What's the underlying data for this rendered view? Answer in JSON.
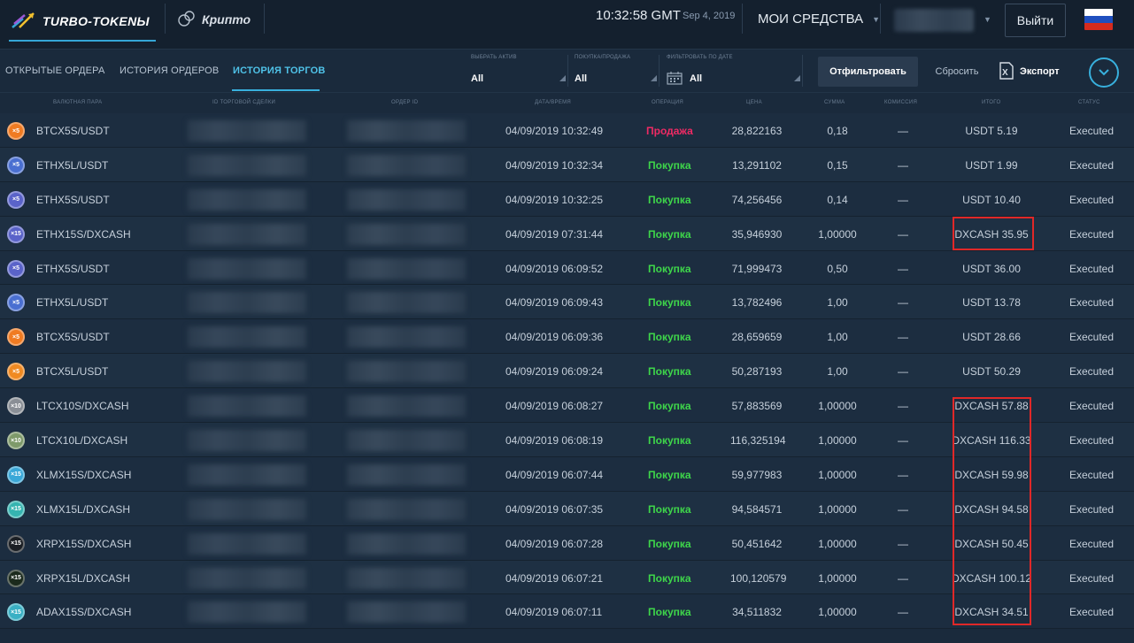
{
  "header": {
    "brand": "TURBO-TOKENЫ",
    "crypto_label": "Крипто",
    "time": "10:32:58 GMT",
    "date": "Sep 4, 2019",
    "funds_label": "МОИ СРЕДСТВА",
    "logout_label": "Выйти"
  },
  "tabs": [
    {
      "label": "ОТКРЫТЫЕ ОРДЕРА",
      "active": false
    },
    {
      "label": "ИСТОРИЯ ОРДЕРОВ",
      "active": false
    },
    {
      "label": "ИСТОРИЯ ТОРГОВ",
      "active": true
    }
  ],
  "filters": {
    "asset": {
      "label": "ВЫБРАТЬ АКТИВ",
      "value": "All"
    },
    "side": {
      "label": "ПОКУПКА/ПРОДАЖА",
      "value": "All"
    },
    "date": {
      "label": "ФИЛЬТРОВАТЬ ПО ДАТЕ",
      "value": "All"
    },
    "apply_label": "Отфильтровать",
    "reset_label": "Сбросить",
    "export_label": "Экспорт"
  },
  "columns": [
    "ВАЛЮТНАЯ ПАРА",
    "ID ТОРГОВОЙ СДЕЛКИ",
    "ОРДЕР ID",
    "ДАТА/ВРЕМЯ",
    "ОПЕРАЦИЯ",
    "ЦЕНА",
    "СУММА",
    "КОМИССИЯ",
    "ИТОГО",
    "СТАТУС"
  ],
  "rows": [
    {
      "pair": "BTCX5S/USDT",
      "badge": "×5",
      "coin_color": "#f07b22",
      "datetime": "04/09/2019 10:32:49",
      "op": "Продажа",
      "side": "sell",
      "price": "28,822163",
      "amount": "0,18",
      "fee": "—",
      "total": "USDT 5.19",
      "status": "Executed"
    },
    {
      "pair": "ETHX5L/USDT",
      "badge": "×5",
      "coin_color": "#4a6fd1",
      "datetime": "04/09/2019 10:32:34",
      "op": "Покупка",
      "side": "buy",
      "price": "13,291102",
      "amount": "0,15",
      "fee": "—",
      "total": "USDT 1.99",
      "status": "Executed"
    },
    {
      "pair": "ETHX5S/USDT",
      "badge": "×5",
      "coin_color": "#5a63c9",
      "datetime": "04/09/2019 10:32:25",
      "op": "Покупка",
      "side": "buy",
      "price": "74,256456",
      "amount": "0,14",
      "fee": "—",
      "total": "USDT 10.40",
      "status": "Executed"
    },
    {
      "pair": "ETHX15S/DXCASH",
      "badge": "×15",
      "coin_color": "#5a63c9",
      "datetime": "04/09/2019 07:31:44",
      "op": "Покупка",
      "side": "buy",
      "price": "35,946930",
      "amount": "1,00000",
      "fee": "—",
      "total": "DXCASH 35.95",
      "status": "Executed"
    },
    {
      "pair": "ETHX5S/USDT",
      "badge": "×5",
      "coin_color": "#5a63c9",
      "datetime": "04/09/2019 06:09:52",
      "op": "Покупка",
      "side": "buy",
      "price": "71,999473",
      "amount": "0,50",
      "fee": "—",
      "total": "USDT 36.00",
      "status": "Executed"
    },
    {
      "pair": "ETHX5L/USDT",
      "badge": "×5",
      "coin_color": "#4a6fd1",
      "datetime": "04/09/2019 06:09:43",
      "op": "Покупка",
      "side": "buy",
      "price": "13,782496",
      "amount": "1,00",
      "fee": "—",
      "total": "USDT 13.78",
      "status": "Executed"
    },
    {
      "pair": "BTCX5S/USDT",
      "badge": "×5",
      "coin_color": "#f07b22",
      "datetime": "04/09/2019 06:09:36",
      "op": "Покупка",
      "side": "buy",
      "price": "28,659659",
      "amount": "1,00",
      "fee": "—",
      "total": "USDT 28.66",
      "status": "Executed"
    },
    {
      "pair": "BTCX5L/USDT",
      "badge": "×5",
      "coin_color": "#f08a22",
      "datetime": "04/09/2019 06:09:24",
      "op": "Покупка",
      "side": "buy",
      "price": "50,287193",
      "amount": "1,00",
      "fee": "—",
      "total": "USDT 50.29",
      "status": "Executed"
    },
    {
      "pair": "LTCX10S/DXCASH",
      "badge": "×10",
      "coin_color": "#8a8f96",
      "datetime": "04/09/2019 06:08:27",
      "op": "Покупка",
      "side": "buy",
      "price": "57,883569",
      "amount": "1,00000",
      "fee": "—",
      "total": "DXCASH 57.88",
      "status": "Executed"
    },
    {
      "pair": "LTCX10L/DXCASH",
      "badge": "×10",
      "coin_color": "#7e9a6a",
      "datetime": "04/09/2019 06:08:19",
      "op": "Покупка",
      "side": "buy",
      "price": "116,325194",
      "amount": "1,00000",
      "fee": "—",
      "total": "DXCASH 116.33",
      "status": "Executed"
    },
    {
      "pair": "XLMX15S/DXCASH",
      "badge": "×15",
      "coin_color": "#3aa8d8",
      "datetime": "04/09/2019 06:07:44",
      "op": "Покупка",
      "side": "buy",
      "price": "59,977983",
      "amount": "1,00000",
      "fee": "—",
      "total": "DXCASH 59.98",
      "status": "Executed"
    },
    {
      "pair": "XLMX15L/DXCASH",
      "badge": "×15",
      "coin_color": "#35b4b0",
      "datetime": "04/09/2019 06:07:35",
      "op": "Покупка",
      "side": "buy",
      "price": "94,584571",
      "amount": "1,00000",
      "fee": "—",
      "total": "DXCASH 94.58",
      "status": "Executed"
    },
    {
      "pair": "XRPX15S/DXCASH",
      "badge": "×15",
      "coin_color": "#1b1f24",
      "datetime": "04/09/2019 06:07:28",
      "op": "Покупка",
      "side": "buy",
      "price": "50,451642",
      "amount": "1,00000",
      "fee": "—",
      "total": "DXCASH 50.45",
      "status": "Executed"
    },
    {
      "pair": "XRPX15L/DXCASH",
      "badge": "×15",
      "coin_color": "#1b2a1c",
      "datetime": "04/09/2019 06:07:21",
      "op": "Покупка",
      "side": "buy",
      "price": "100,120579",
      "amount": "1,00000",
      "fee": "—",
      "total": "DXCASH 100.12",
      "status": "Executed"
    },
    {
      "pair": "ADAX15S/DXCASH",
      "badge": "×15",
      "coin_color": "#3ab0c4",
      "datetime": "04/09/2019 06:07:11",
      "op": "Покупка",
      "side": "buy",
      "price": "34,511832",
      "amount": "1,00000",
      "fee": "—",
      "total": "DXCASH 34.51",
      "status": "Executed"
    }
  ],
  "colors": {
    "accent": "#38b0dd",
    "buy": "#3ed64a",
    "sell": "#ee2a64",
    "highlight": "#e02828"
  }
}
